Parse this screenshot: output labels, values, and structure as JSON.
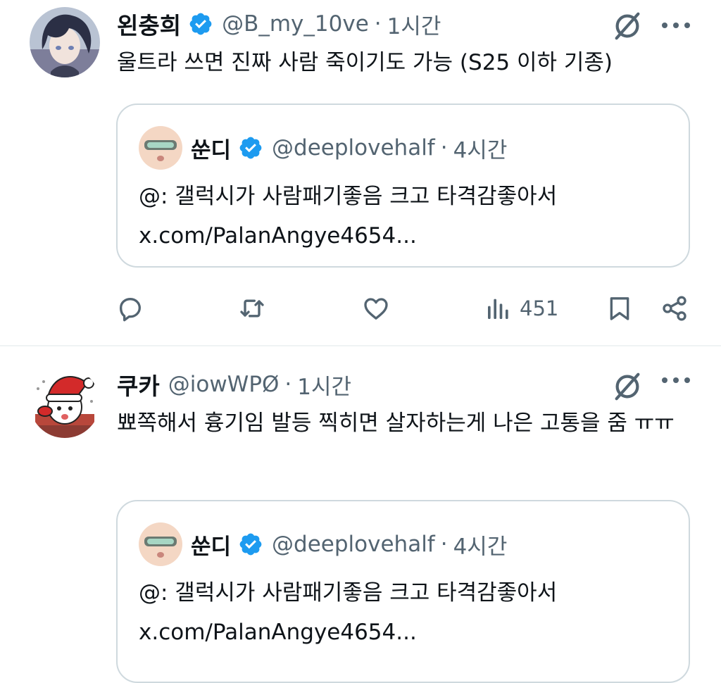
{
  "tweets": [
    {
      "name": "왼충희",
      "handle": "@B_my_10ve",
      "separator": "·",
      "time": "1시간",
      "text": "울트라 쓰면 진짜 사람 죽이기도 가능 (S25 이하 기종)",
      "quote": {
        "name": "쑨디",
        "handle": "@deeplovehalf",
        "separator": "·",
        "time": "4시간",
        "line1": "@: 갤럭시가 사람패기좋음 크고 타격감좋아서",
        "line2": "x.com/PalanAngye4654..."
      },
      "actions": {
        "views": "451"
      }
    },
    {
      "name": "쿠카",
      "handle": "@iowWPØ",
      "separator": "·",
      "time": "1시간",
      "text": "뾰쪽해서 흉기임 발등 찍히면 살자하는게 나은 고통을 줌 ㅠㅠ",
      "quote": {
        "name": "쑨디",
        "handle": "@deeplovehalf",
        "separator": "·",
        "time": "4시간",
        "line1": "@: 갤럭시가 사람패기좋음 크고 타격감좋아서",
        "line2": "x.com/PalanAngye4654..."
      }
    }
  ],
  "icons": {
    "verified": "verified-badge-icon",
    "grok": "grok-icon",
    "more": "more-dots-icon",
    "reply": "reply-icon",
    "retweet": "retweet-icon",
    "like": "heart-icon",
    "views": "views-bar-icon",
    "bookmark": "bookmark-icon",
    "share": "share-icon"
  },
  "colors": {
    "text": "#0f1419",
    "secondary": "#536471",
    "verified": "#1d9bf0",
    "border": "#cfd9de"
  }
}
